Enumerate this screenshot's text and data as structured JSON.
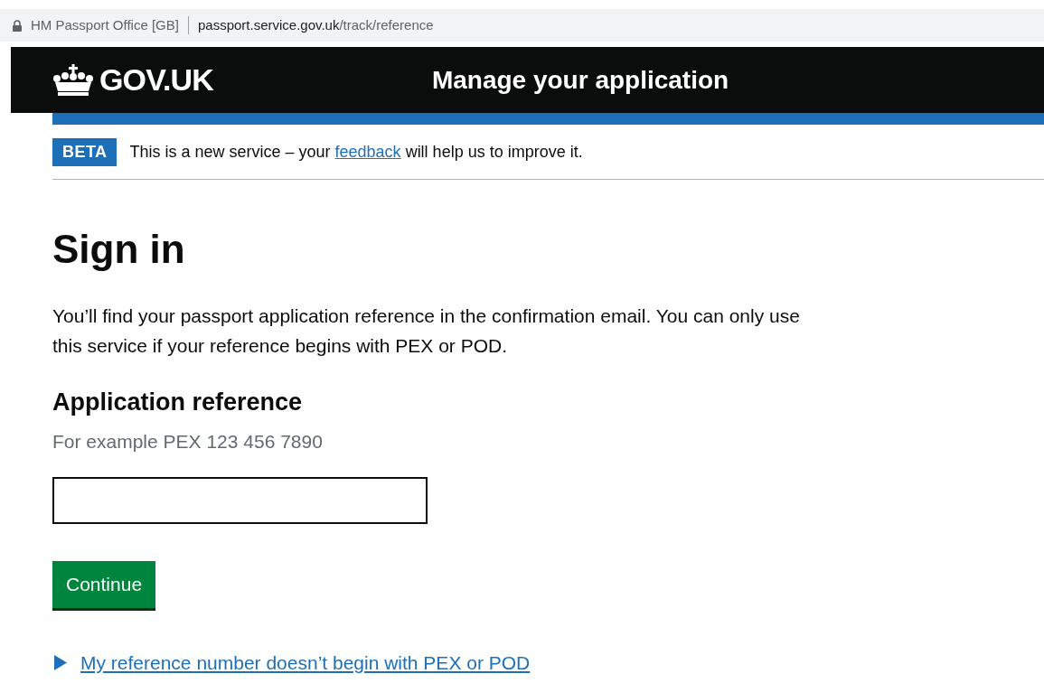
{
  "address_bar": {
    "site_name": "HM Passport Office [GB]",
    "url_host": "passport.service.gov.uk",
    "url_path": "/track/reference"
  },
  "header": {
    "logo": "GOV.UK",
    "service_name": "Manage your application"
  },
  "phase_banner": {
    "tag": "BETA",
    "text_before": "This is a new service – your ",
    "link": "feedback",
    "text_after": " will help us to improve it."
  },
  "heading": "Sign in",
  "intro": "You’ll find your passport application reference in the confirmation email. You can only use this service if your reference begins with PEX or POD.",
  "field": {
    "label": "Application reference",
    "hint": "For example PEX 123 456 7890"
  },
  "button": "Continue",
  "details": {
    "summary": "My reference number doesn’t begin with PEX or POD",
    "expanded": false
  }
}
